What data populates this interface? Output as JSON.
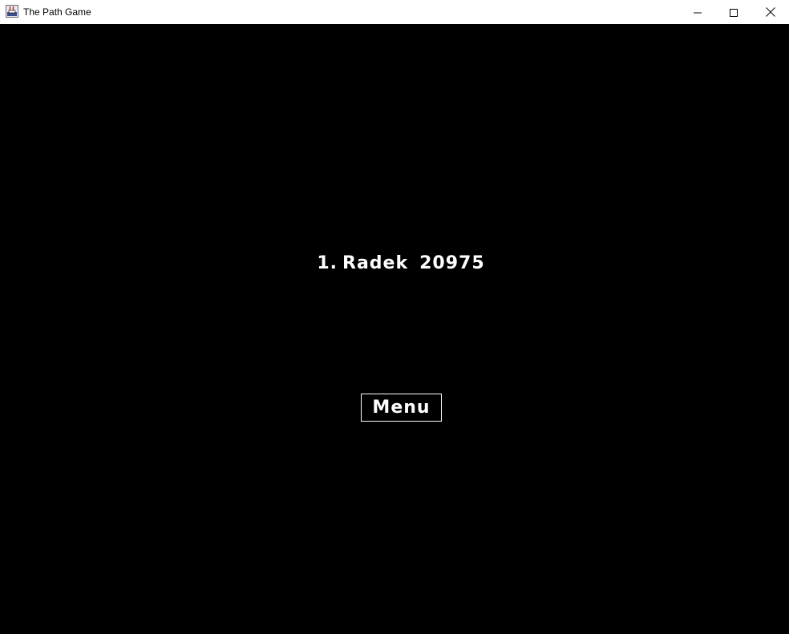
{
  "window": {
    "title": "The Path Game",
    "icon": "java-app-icon",
    "controls": {
      "minimize_icon": "minimize-icon",
      "maximize_icon": "maximize-icon",
      "close_icon": "close-icon"
    }
  },
  "highscores": {
    "entries": [
      {
        "rank": "1.",
        "name": "Radek",
        "score": "20975"
      }
    ]
  },
  "menu_button": {
    "label": "Menu"
  },
  "colors": {
    "background": "#000000",
    "text": "#ffffff",
    "titlebar": "#ffffff"
  }
}
